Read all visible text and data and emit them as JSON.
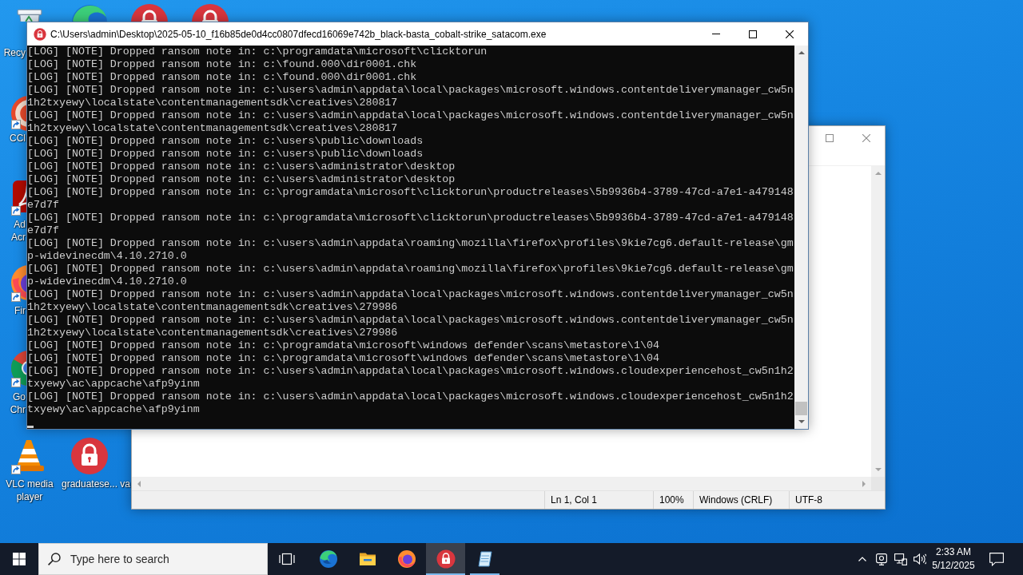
{
  "desktop": {
    "icons": [
      {
        "kind": "recycle-bin",
        "label": "Recy",
        "shortcut": false
      },
      {
        "kind": "edge",
        "shortcut": false
      },
      {
        "kind": "lock",
        "shortcut": false
      },
      {
        "kind": "lock",
        "shortcut": false
      },
      {
        "kind": "ccleaner",
        "label": "CCl",
        "shortcut": true
      },
      {
        "kind": "acrobat",
        "label": "Ad Acr",
        "shortcut": true
      },
      {
        "kind": "firefox",
        "label": "Fir",
        "shortcut": true
      },
      {
        "kind": "chrome",
        "label": "Go Chr",
        "shortcut": true
      },
      {
        "kind": "vlc",
        "label": "VLC media player",
        "shortcut": true
      },
      {
        "kind": "lock",
        "label": "graduatese...",
        "shortcut": false
      },
      {
        "kind": "hidden",
        "label": "va",
        "shortcut": false
      }
    ]
  },
  "console_window": {
    "title": "C:\\Users\\admin\\Desktop\\2025-05-10_f16b85de0d4cc0807dfecd16069e742b_black-basta_cobalt-strike_satacom.exe",
    "lines": [
      "[LOG] [NOTE] Dropped ransom note in: c:\\programdata\\microsoft\\clicktorun",
      "[LOG] [NOTE] Dropped ransom note in: c:\\found.000\\dir0001.chk",
      "[LOG] [NOTE] Dropped ransom note in: c:\\found.000\\dir0001.chk",
      "[LOG] [NOTE] Dropped ransom note in: c:\\users\\admin\\appdata\\local\\packages\\microsoft.windows.contentdeliverymanager_cw5n1h2txyewy\\localstate\\contentmanagementsdk\\creatives\\280817",
      "[LOG] [NOTE] Dropped ransom note in: c:\\users\\admin\\appdata\\local\\packages\\microsoft.windows.contentdeliverymanager_cw5n1h2txyewy\\localstate\\contentmanagementsdk\\creatives\\280817",
      "[LOG] [NOTE] Dropped ransom note in: c:\\users\\public\\downloads",
      "[LOG] [NOTE] Dropped ransom note in: c:\\users\\public\\downloads",
      "[LOG] [NOTE] Dropped ransom note in: c:\\users\\administrator\\desktop",
      "[LOG] [NOTE] Dropped ransom note in: c:\\users\\administrator\\desktop",
      "[LOG] [NOTE] Dropped ransom note in: c:\\programdata\\microsoft\\clicktorun\\productreleases\\5b9936b4-3789-47cd-a7e1-a479148e7d7f",
      "[LOG] [NOTE] Dropped ransom note in: c:\\programdata\\microsoft\\clicktorun\\productreleases\\5b9936b4-3789-47cd-a7e1-a479148e7d7f",
      "[LOG] [NOTE] Dropped ransom note in: c:\\users\\admin\\appdata\\roaming\\mozilla\\firefox\\profiles\\9kie7cg6.default-release\\gmp-widevinecdm\\4.10.2710.0",
      "[LOG] [NOTE] Dropped ransom note in: c:\\users\\admin\\appdata\\roaming\\mozilla\\firefox\\profiles\\9kie7cg6.default-release\\gmp-widevinecdm\\4.10.2710.0",
      "[LOG] [NOTE] Dropped ransom note in: c:\\users\\admin\\appdata\\local\\packages\\microsoft.windows.contentdeliverymanager_cw5n1h2txyewy\\localstate\\contentmanagementsdk\\creatives\\279986",
      "[LOG] [NOTE] Dropped ransom note in: c:\\users\\admin\\appdata\\local\\packages\\microsoft.windows.contentdeliverymanager_cw5n1h2txyewy\\localstate\\contentmanagementsdk\\creatives\\279986",
      "[LOG] [NOTE] Dropped ransom note in: c:\\programdata\\microsoft\\windows defender\\scans\\metastore\\1\\04",
      "[LOG] [NOTE] Dropped ransom note in: c:\\programdata\\microsoft\\windows defender\\scans\\metastore\\1\\04",
      "[LOG] [NOTE] Dropped ransom note in: c:\\users\\admin\\appdata\\local\\packages\\microsoft.windows.cloudexperiencehost_cw5n1h2txyewy\\ac\\appcache\\afp9yinm",
      "[LOG] [NOTE] Dropped ransom note in: c:\\users\\admin\\appdata\\local\\packages\\microsoft.windows.cloudexperiencehost_cw5n1h2txyewy\\ac\\appcache\\afp9yinm"
    ],
    "cursor": true
  },
  "notepad_window": {
    "status_bar": [
      "Ln 1, Col 1",
      "100%",
      "Windows (CRLF)",
      "UTF-8"
    ]
  },
  "taskbar": {
    "search": {
      "placeholder": "Type here to search"
    },
    "apps": [
      {
        "kind": "edge",
        "selected": false,
        "running": false
      },
      {
        "kind": "folder",
        "selected": false,
        "running": false
      },
      {
        "kind": "firefox",
        "selected": false,
        "running": false
      },
      {
        "kind": "lock",
        "selected": true,
        "running": true
      },
      {
        "kind": "notepad",
        "selected": false,
        "running": true
      }
    ],
    "clock": {
      "time": "2:33 AM",
      "date": "5/12/2025"
    }
  }
}
